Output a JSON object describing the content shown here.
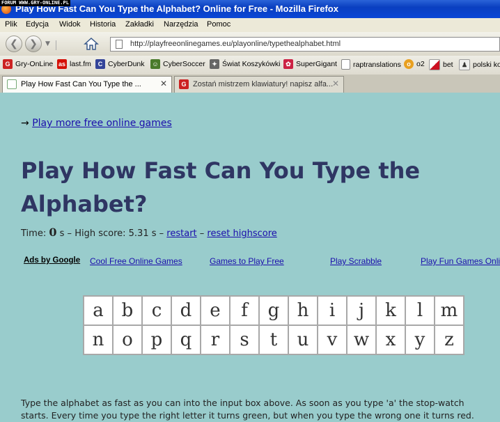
{
  "watermark": "FORUM WWW.GRY-ONLINE.PL",
  "window": {
    "title": "Play How Fast Can You Type the Alphabet? Online for Free - Mozilla Firefox"
  },
  "menu": [
    "Plik",
    "Edycja",
    "Widok",
    "Historia",
    "Zakładki",
    "Narzędzia",
    "Pomoc"
  ],
  "nav": {
    "url": "http://playfreeonlinegames.eu/playonline/typethealphabet.html"
  },
  "bookmarks": [
    {
      "label": "Gry-OnLine",
      "icon": "gry-online-icon",
      "color": "#cc2222",
      "glyph": "G"
    },
    {
      "label": "last.fm",
      "icon": "lastfm-icon",
      "color": "#d51007",
      "glyph": "as"
    },
    {
      "label": "CyberDunk",
      "icon": "cyberdunk-icon",
      "color": "#334499",
      "glyph": "C"
    },
    {
      "label": "CyberSoccer",
      "icon": "cybersoccer-icon",
      "color": "#4a7a2a",
      "glyph": "☺"
    },
    {
      "label": "Świat Koszykówki",
      "icon": "basketball-player-icon",
      "color": "#666666",
      "glyph": "✦"
    },
    {
      "label": "SuperGigant",
      "icon": "supergigant-icon",
      "color": "#cc2244",
      "glyph": "✿"
    },
    {
      "label": "raptranslations",
      "icon": "page-icon",
      "color": "#ffffff",
      "glyph": ""
    },
    {
      "label": "o2",
      "icon": "o2-icon",
      "color": "#e8a020",
      "glyph": "o"
    },
    {
      "label": "bet",
      "icon": "bet-icon",
      "color": "#cc1122",
      "glyph": ""
    },
    {
      "label": "polski ko",
      "icon": "polski-icon",
      "color": "#333333",
      "glyph": "♟"
    }
  ],
  "tabs": [
    {
      "label": "Play How Fast Can You Type the ...",
      "close": "✕",
      "active": true
    },
    {
      "label": "Zostań mistrzem klawiatury! napisz alfa...",
      "close": "✕",
      "active": false
    }
  ],
  "page": {
    "more_arrow": "→",
    "more_link": "Play more free online games",
    "heading": "Play How Fast Can You Type the Alphabet?",
    "status": {
      "time_label": "Time:",
      "time_value": "0",
      "time_unit": "s",
      "sep1": "–",
      "highscore_label": "High score:",
      "highscore_value": "5.31 s",
      "sep2": "–",
      "restart": "restart",
      "sep3": "–",
      "reset": "reset highscore"
    },
    "ads": {
      "label": "Ads by Google",
      "links": [
        "Cool Free Online Games",
        "Games to Play Free",
        "Play Scrabble",
        "Play Fun Games Online"
      ]
    },
    "letters_row1": [
      "a",
      "b",
      "c",
      "d",
      "e",
      "f",
      "g",
      "h",
      "i",
      "j",
      "k",
      "l",
      "m"
    ],
    "letters_row2": [
      "n",
      "o",
      "p",
      "q",
      "r",
      "s",
      "t",
      "u",
      "v",
      "w",
      "x",
      "y",
      "z"
    ],
    "instructions": [
      "Type the alphabet as fast as you can into the input box above. As soon as you type 'a' the stop-watch",
      "starts. Every time you type the right letter it turns green, but when you type the wrong one it turns red."
    ]
  }
}
